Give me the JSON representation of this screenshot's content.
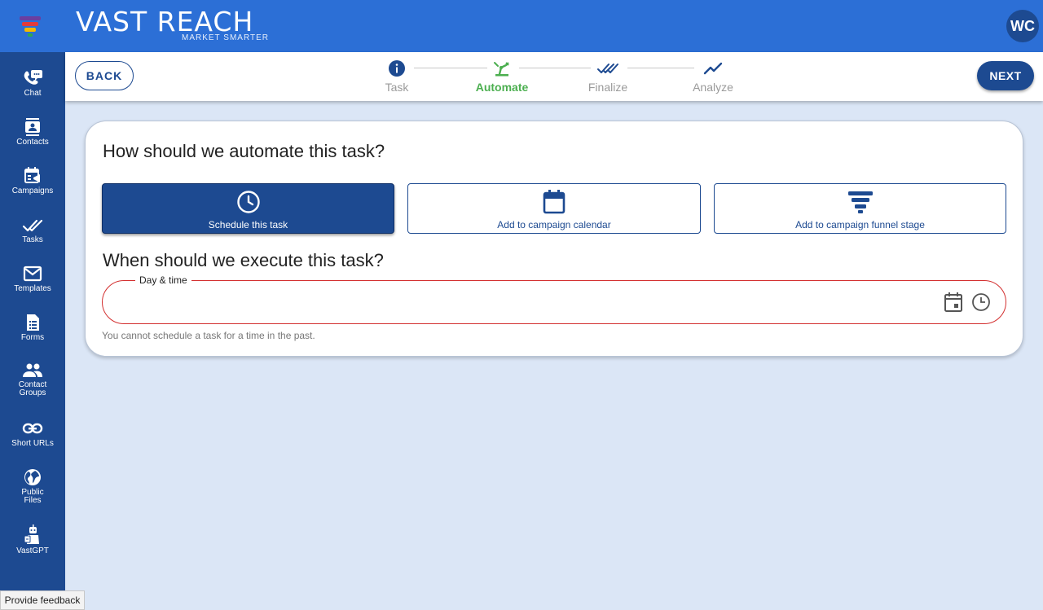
{
  "app": {
    "brand_title": "VAST REACH",
    "brand_tagline": "MARKET SMARTER",
    "avatar_initials": "WC",
    "colors": {
      "primary": "#1d4a91",
      "header": "#2c6fd6",
      "active_step": "#4caf50",
      "error": "#d32f2f",
      "background": "#dbe6f6"
    }
  },
  "sidebar": {
    "items": [
      {
        "label": "Chat",
        "icon": "chat-icon"
      },
      {
        "label": "Contacts",
        "icon": "contacts-icon"
      },
      {
        "label": "Campaigns",
        "icon": "campaigns-icon"
      },
      {
        "label": "Tasks",
        "icon": "tasks-icon"
      },
      {
        "label": "Templates",
        "icon": "email-icon"
      },
      {
        "label": "Forms",
        "icon": "forms-icon"
      },
      {
        "label": "Contact",
        "label2": "Groups",
        "icon": "groups-icon"
      },
      {
        "label": "Short URLs",
        "icon": "link-icon"
      },
      {
        "label": "Public",
        "label2": "Files",
        "icon": "globe-icon"
      },
      {
        "label": "VastGPT",
        "icon": "robot-icon"
      }
    ]
  },
  "feedback": {
    "label": "Provide feedback"
  },
  "stepper": {
    "back_label": "BACK",
    "next_label": "NEXT",
    "steps": [
      {
        "label": "Task",
        "icon": "info-icon",
        "active": false
      },
      {
        "label": "Automate",
        "icon": "automate-icon",
        "active": true
      },
      {
        "label": "Finalize",
        "icon": "double-check-icon",
        "active": false
      },
      {
        "label": "Analyze",
        "icon": "trend-icon",
        "active": false
      }
    ]
  },
  "form": {
    "question_automate": "How should we automate this task?",
    "options": [
      {
        "label": "Schedule this task",
        "icon": "clock-icon",
        "selected": true
      },
      {
        "label": "Add to campaign calendar",
        "icon": "calendar-icon",
        "selected": false
      },
      {
        "label": "Add to campaign funnel stage",
        "icon": "funnel-icon",
        "selected": false
      }
    ],
    "question_execute": "When should we execute this task?",
    "datetime": {
      "label": "Day & time",
      "value": ""
    },
    "helper_text": "You cannot schedule a task for a time in the past."
  }
}
